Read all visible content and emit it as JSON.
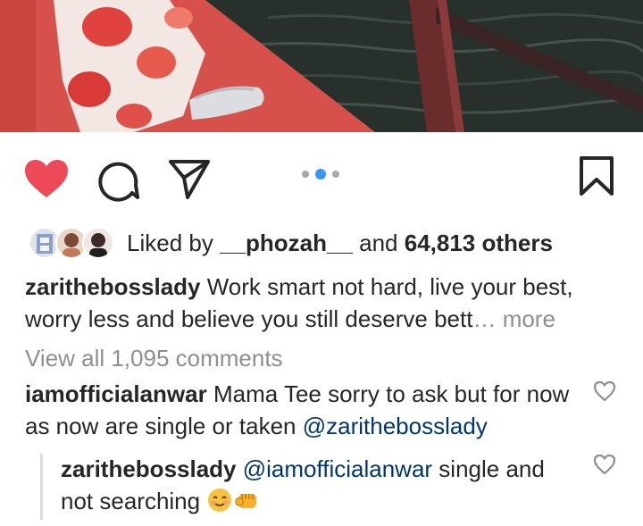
{
  "post": {
    "carousel": {
      "slide_count": 3,
      "active_index": 1
    }
  },
  "actions": {
    "like_icon": "heart-filled-icon",
    "comment_icon": "comment-bubble-icon",
    "share_icon": "paper-plane-icon",
    "save_icon": "bookmark-icon",
    "liked": true
  },
  "likes": {
    "prefix": "Liked by ",
    "first_liker": "__phozah__",
    "conjunction": " and ",
    "others": "64,813 others"
  },
  "caption": {
    "username": "zarithebosslady",
    "text": " Work smart not hard, live your best, worry less and believe you still deserve bett",
    "more": "… more"
  },
  "comments": {
    "view_all": "View all 1,095 comments",
    "items": [
      {
        "username": "iamofficialanwar",
        "text": " Mama Tee sorry to ask but for now as now are single or taken ",
        "mention": "@zarithebosslady"
      }
    ],
    "reply": {
      "username": "zarithebosslady",
      "mention": " @iamofficialanwar",
      "text": " single and not searching "
    }
  },
  "colors": {
    "like_red": "#ed4956",
    "text": "#262626",
    "muted": "#8e8e8e",
    "mention": "#00376b",
    "carousel_active": "#3897f0"
  }
}
